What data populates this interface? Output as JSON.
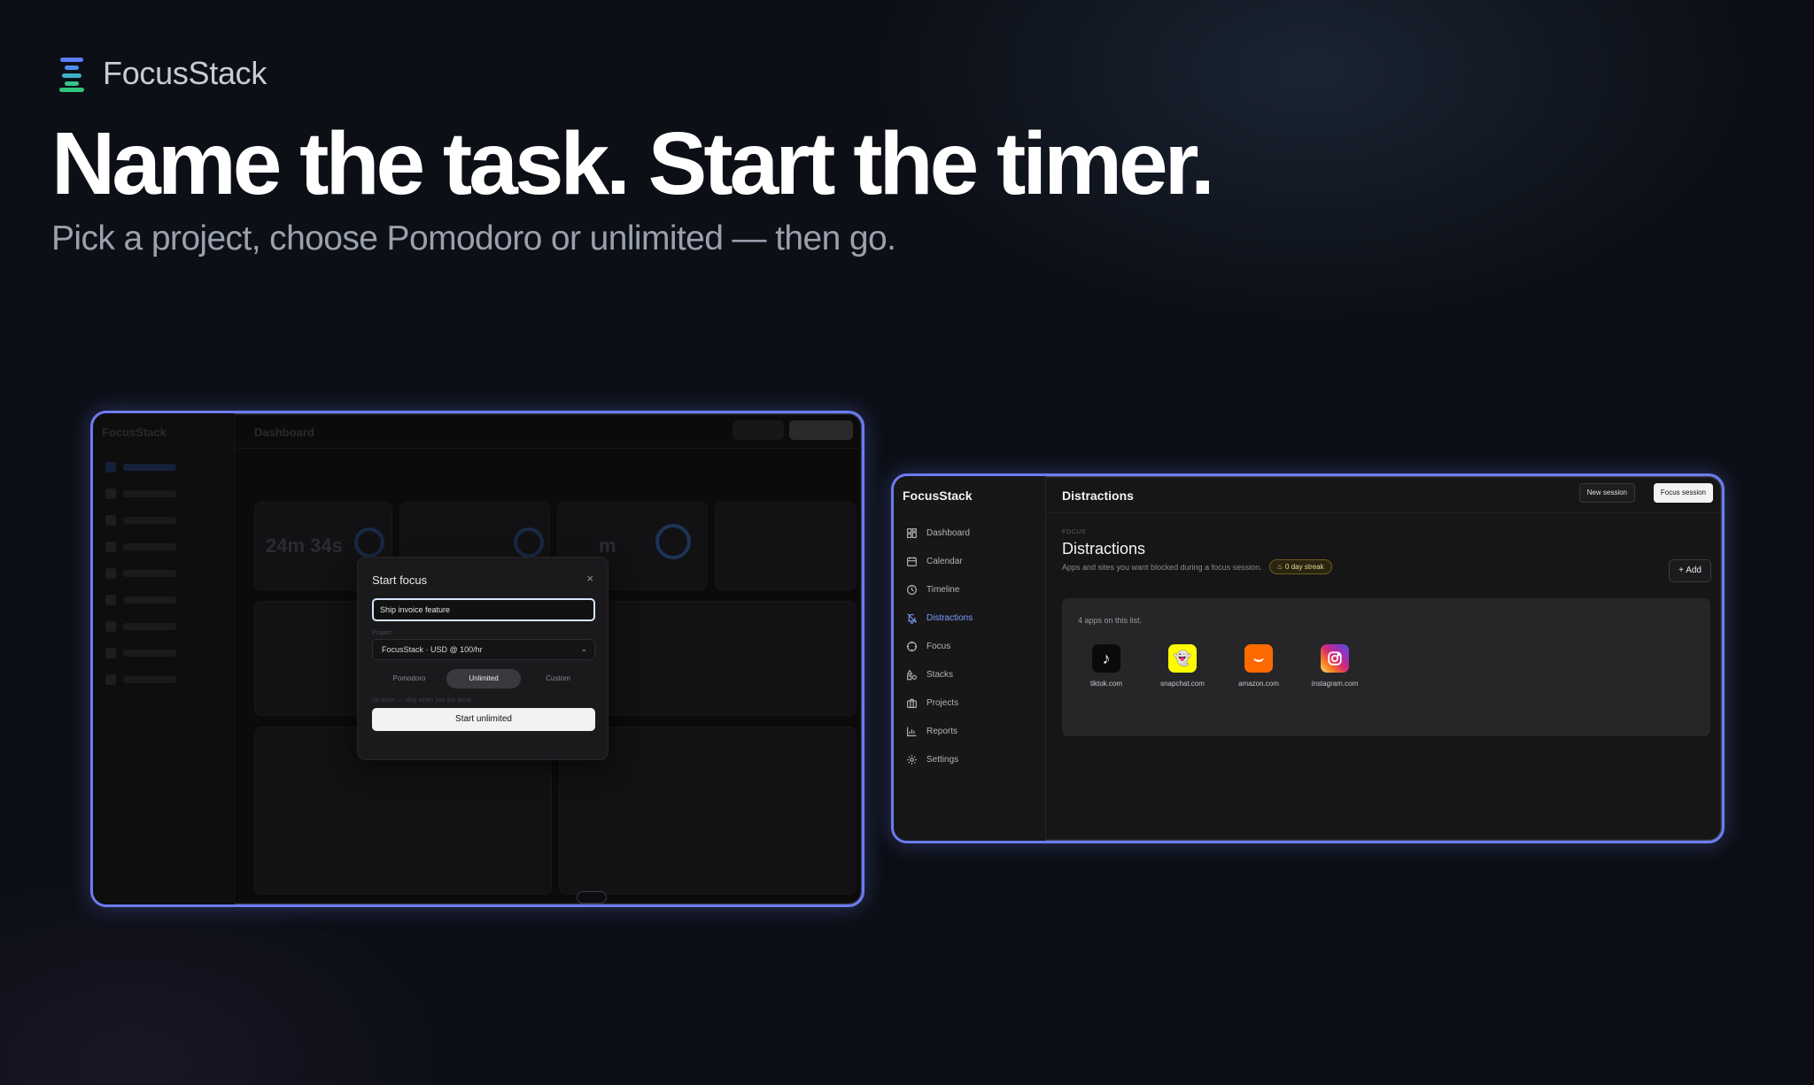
{
  "brand": {
    "name": "FocusStack"
  },
  "hero": {
    "headline": "Name the task. Start the timer.",
    "subhead": "Pick a project, choose Pomodoro or unlimited — then go."
  },
  "left_screen": {
    "sidebar_title": "FocusStack",
    "page_title": "Dashboard",
    "stat_time": "24m 34s",
    "stat_time_right": "m",
    "ring_value": "100%",
    "modal": {
      "title": "Start focus",
      "close": "×",
      "task_value": "Ship invoice feature",
      "project_label": "Project",
      "project_value": "FocusStack · USD @ 100/hr",
      "modes": [
        "Pomodoro",
        "Unlimited",
        "Custom"
      ],
      "active_mode": "Unlimited",
      "hint": "No timer — stop when you are done",
      "start_label": "Start unlimited"
    }
  },
  "right_screen": {
    "brand": "FocusStack",
    "page_title": "Distractions",
    "new_session_label": "New session",
    "focus_session_label": "Focus session",
    "nav": [
      {
        "label": "Dashboard",
        "icon": "grid-icon"
      },
      {
        "label": "Calendar",
        "icon": "calendar-icon"
      },
      {
        "label": "Timeline",
        "icon": "clock-icon"
      },
      {
        "label": "Distractions",
        "icon": "bell-off-icon",
        "active": true
      },
      {
        "label": "Focus",
        "icon": "target-icon"
      },
      {
        "label": "Stacks",
        "icon": "shapes-icon"
      },
      {
        "label": "Projects",
        "icon": "briefcase-icon"
      },
      {
        "label": "Reports",
        "icon": "bar-chart-icon"
      },
      {
        "label": "Settings",
        "icon": "gear-icon"
      }
    ],
    "eyebrow": "FOCUS",
    "heading": "Distractions",
    "description": "Apps and sites you want blocked during a focus session.",
    "streak": "0 day streak",
    "add_label": "Add",
    "list_count": "4 apps on this list.",
    "apps": [
      {
        "label": "tiktok.com",
        "icon": "tiktok-icon",
        "color": "#000000"
      },
      {
        "label": "snapchat.com",
        "icon": "snapchat-icon",
        "color": "#FFFC00"
      },
      {
        "label": "amazon.com",
        "icon": "amazon-icon",
        "color": "#FF6A00"
      },
      {
        "label": "instagram.com",
        "icon": "instagram-icon",
        "color": "#D62976"
      }
    ]
  },
  "colors": {
    "accent": "#6d7cf0",
    "active_nav": "#7c9cff"
  }
}
